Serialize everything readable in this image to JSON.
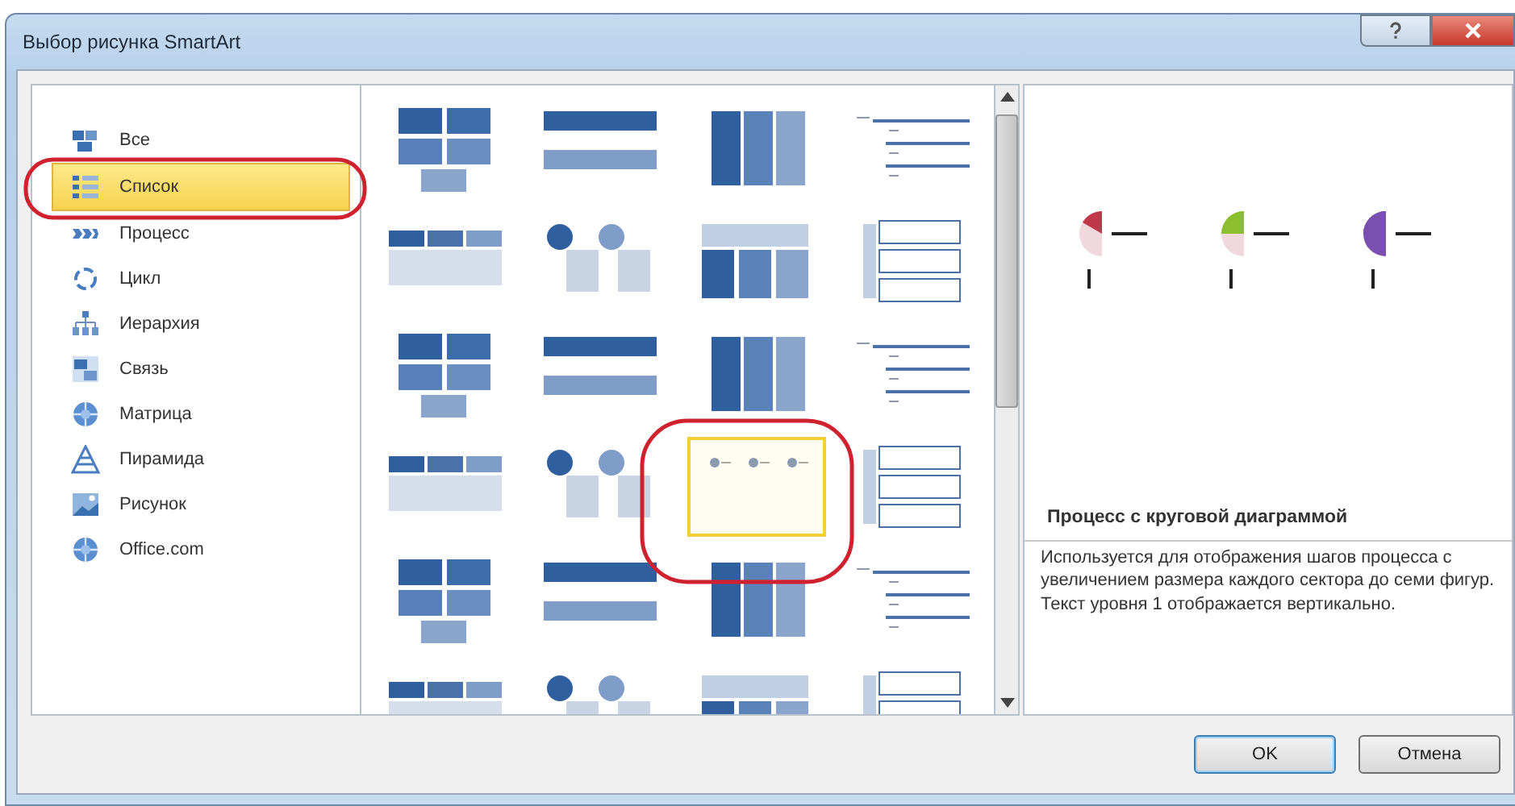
{
  "window": {
    "title": "Выбор рисунка SmartArt"
  },
  "categories": [
    {
      "label": "Все",
      "selected": false
    },
    {
      "label": "Список",
      "selected": true
    },
    {
      "label": "Процесс",
      "selected": false
    },
    {
      "label": "Цикл",
      "selected": false
    },
    {
      "label": "Иерархия",
      "selected": false
    },
    {
      "label": "Связь",
      "selected": false
    },
    {
      "label": "Матрица",
      "selected": false
    },
    {
      "label": "Пирамида",
      "selected": false
    },
    {
      "label": "Рисунок",
      "selected": false
    },
    {
      "label": "Office.com",
      "selected": false
    }
  ],
  "gallery": {
    "items": [
      {
        "selected": false
      },
      {
        "selected": false
      },
      {
        "selected": false
      },
      {
        "selected": false
      },
      {
        "selected": false
      },
      {
        "selected": false
      },
      {
        "selected": false
      },
      {
        "selected": false
      },
      {
        "selected": false
      },
      {
        "selected": false
      },
      {
        "selected": false
      },
      {
        "selected": false
      },
      {
        "selected": false
      },
      {
        "selected": false
      },
      {
        "selected": true
      },
      {
        "selected": false
      },
      {
        "selected": false
      },
      {
        "selected": false
      },
      {
        "selected": false
      },
      {
        "selected": false
      },
      {
        "selected": false
      },
      {
        "selected": false
      },
      {
        "selected": false
      },
      {
        "selected": false
      }
    ]
  },
  "preview": {
    "title": "Процесс с круговой диаграммой",
    "description": "Используется для отображения шагов процесса с увеличением размера каждого сектора до семи фигур. Текст уровня 1 отображается вертикально."
  },
  "buttons": [
    {
      "label": "OK",
      "default": true
    },
    {
      "label": "Отмена",
      "default": false
    }
  ]
}
